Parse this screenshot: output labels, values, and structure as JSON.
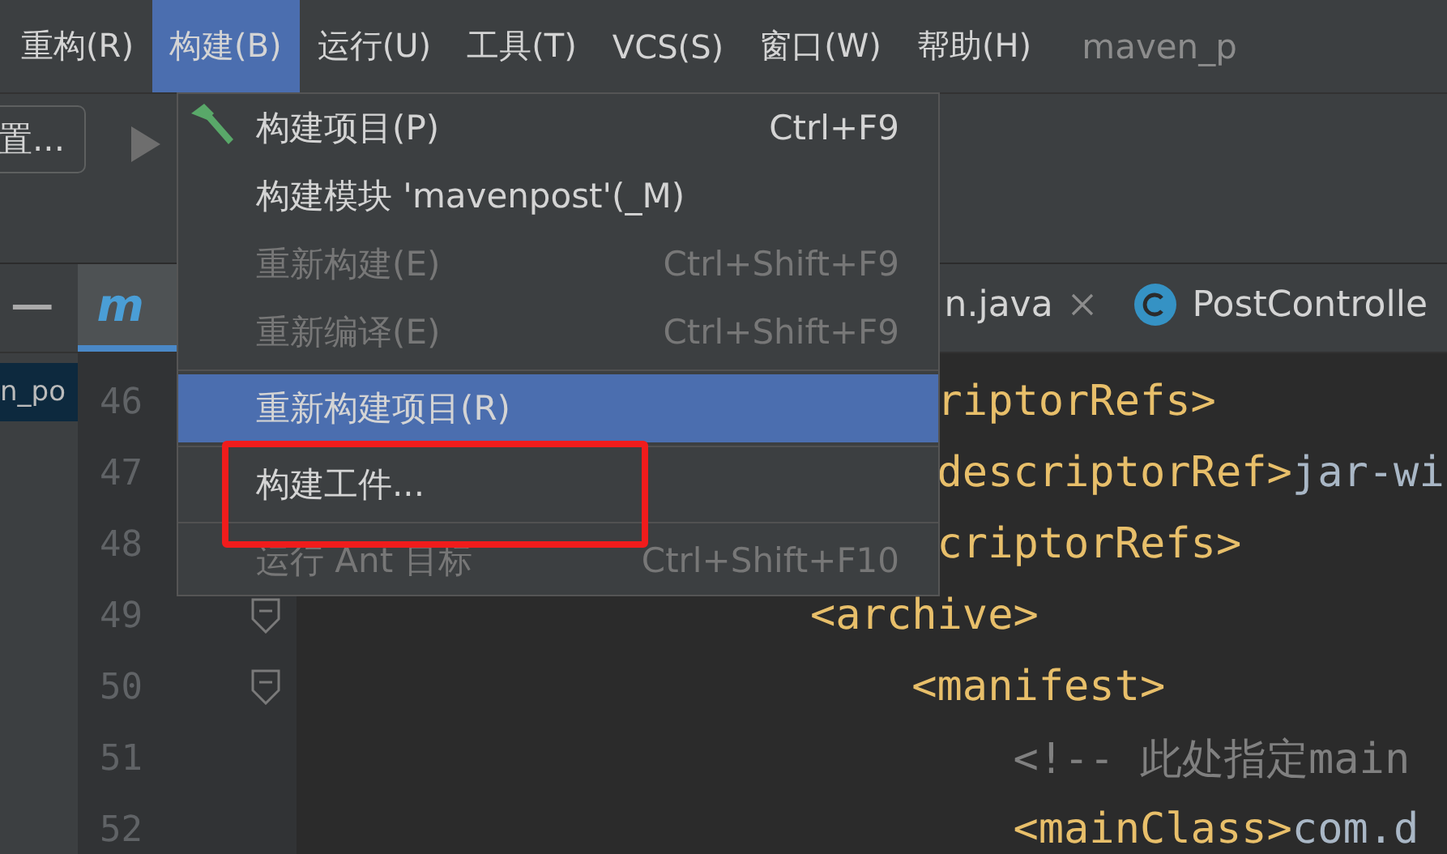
{
  "menu_bar": {
    "items": [
      {
        "label": "重构(R)",
        "selected": false
      },
      {
        "label": "构建(B)",
        "selected": true
      },
      {
        "label": "运行(U)",
        "selected": false
      },
      {
        "label": "工具(T)",
        "selected": false
      },
      {
        "label": "VCS(S)",
        "selected": false
      },
      {
        "label": "窗口(W)",
        "selected": false
      },
      {
        "label": "帮助(H)",
        "selected": false
      }
    ],
    "title": "maven_p"
  },
  "toolbar": {
    "button": "置..."
  },
  "project_panel": {
    "item": "n_po"
  },
  "tabs": [
    {
      "kind": "maven",
      "icon_text": "m",
      "selected": true
    },
    {
      "kind": "file",
      "label": "n.java",
      "selected": false,
      "closable": true
    },
    {
      "kind": "class",
      "label": "PostControlle",
      "selected": false,
      "closable": false
    }
  ],
  "editor": {
    "lines": [
      {
        "number": "46",
        "segments": [
          {
            "kind": "tag",
            "text": "     riptorRefs>"
          }
        ]
      },
      {
        "number": "47",
        "segments": [
          {
            "kind": "tag",
            "text": "     descriptorRef>"
          },
          {
            "kind": "text",
            "text": "jar-wi"
          }
        ]
      },
      {
        "number": "48",
        "segments": [
          {
            "kind": "tag",
            "text": "     criptorRefs>"
          }
        ]
      },
      {
        "number": "49",
        "fold": true,
        "segments": [
          {
            "kind": "tag",
            "text": "<archive>"
          }
        ]
      },
      {
        "number": "50",
        "fold": true,
        "segments": [
          {
            "kind": "tag",
            "text": "    <manifest>"
          }
        ]
      },
      {
        "number": "51",
        "fold": false,
        "segments": [
          {
            "kind": "comment",
            "text": "        <!-- 此处指定main"
          }
        ]
      },
      {
        "number": "52",
        "fold": false,
        "segments": [
          {
            "kind": "tag",
            "text": "        <mainClass>"
          },
          {
            "kind": "text",
            "text": "com.d"
          }
        ]
      }
    ]
  },
  "dropdown_menu": {
    "items": [
      {
        "kind": "item",
        "label": "构建项目(P)",
        "shortcut": "Ctrl+F9",
        "disabled": false,
        "selected": false
      },
      {
        "kind": "item",
        "label": "构建模块 'mavenpost'(_M)",
        "disabled": false,
        "selected": false
      },
      {
        "kind": "item",
        "label": "重新构建(E)",
        "shortcut": "Ctrl+Shift+F9",
        "disabled": true,
        "selected": false
      },
      {
        "kind": "item",
        "label": "重新编译(E)",
        "shortcut": "Ctrl+Shift+F9",
        "disabled": true,
        "selected": false
      },
      {
        "kind": "separator"
      },
      {
        "kind": "item",
        "label": "重新构建项目(R)",
        "disabled": false,
        "selected": true
      },
      {
        "kind": "separator"
      },
      {
        "kind": "item",
        "label": "构建工件...",
        "disabled": false,
        "selected": false
      },
      {
        "kind": "separator"
      },
      {
        "kind": "item",
        "label": "运行 Ant 目标",
        "shortcut": "Ctrl+Shift+F10",
        "disabled": true,
        "selected": false
      }
    ]
  }
}
